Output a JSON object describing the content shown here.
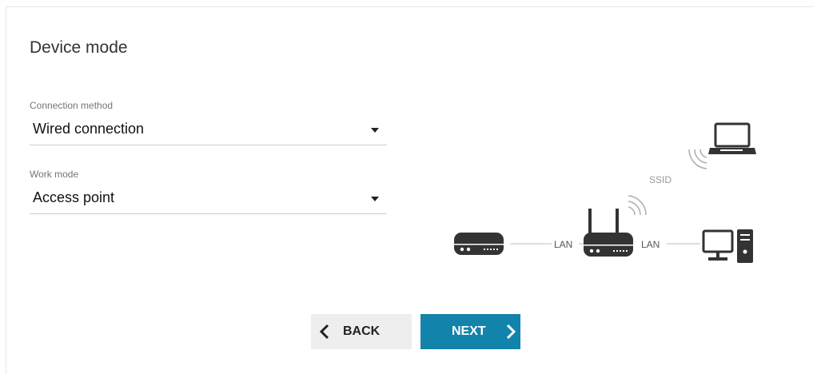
{
  "page": {
    "title": "Device mode"
  },
  "connection_method": {
    "label": "Connection method",
    "value": "Wired connection"
  },
  "work_mode": {
    "label": "Work mode",
    "value": "Access point"
  },
  "diagram": {
    "ssid_label": "SSID",
    "lan_left_label": "LAN",
    "lan_right_label": "LAN"
  },
  "buttons": {
    "back_label": "BACK",
    "next_label": "NEXT"
  },
  "colors": {
    "accent": "#1284ab",
    "diagram": "#333333",
    "diagram_light": "#b0b0b0"
  },
  "icons": [
    "modem-icon",
    "router-icon",
    "laptop-icon",
    "desktop-computer-icon",
    "wifi-signal-icon",
    "chevron-left-icon",
    "chevron-right-icon",
    "dropdown-caret-icon"
  ]
}
